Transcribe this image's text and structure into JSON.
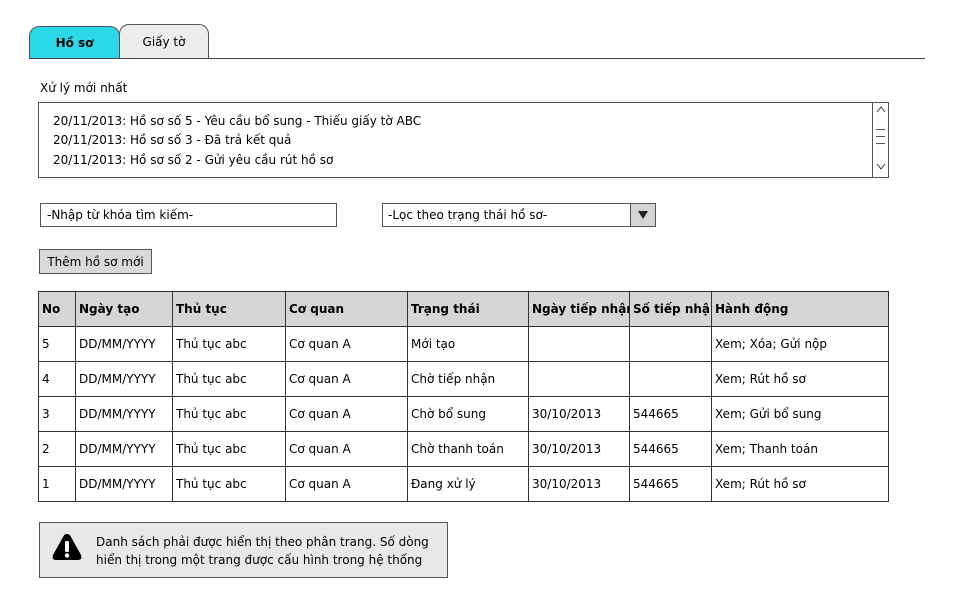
{
  "tabs": [
    {
      "label": "Hồ sơ",
      "active": true
    },
    {
      "label": "Giấy tờ",
      "active": false
    }
  ],
  "recent": {
    "label": "Xử lý mới nhất",
    "lines": [
      "20/11/2013: Hồ sơ số 5 - Yêu cầu bổ sung - Thiếu giấy tờ ABC",
      "20/11/2013: Hồ sơ số 3 - Đã trả kết quả",
      "20/11/2013: Hồ sơ số 2 - Gửi yêu cầu rút hồ sơ"
    ]
  },
  "search": {
    "placeholder": "-Nhập từ khóa tìm kiếm-"
  },
  "filter": {
    "selected": "-Lọc theo trạng thái hồ sơ-"
  },
  "add_button": "Thêm hồ sơ mới",
  "table": {
    "columns": [
      "No",
      "Ngày tạo",
      "Thủ tục",
      "Cơ quan",
      "Trạng thái",
      "Ngày tiếp nhận",
      "Số tiếp nhận",
      "Hành động"
    ],
    "rows": [
      [
        "5",
        "DD/MM/YYYY",
        "Thủ tục abc",
        "Cơ quan A",
        "Mới tạo",
        "",
        "",
        "Xem; Xóa; Gửi nộp"
      ],
      [
        "4",
        "DD/MM/YYYY",
        "Thủ tục abc",
        "Cơ quan A",
        "Chờ tiếp nhận",
        "",
        "",
        "Xem; Rút hồ sơ"
      ],
      [
        "3",
        "DD/MM/YYYY",
        "Thủ tục abc",
        "Cơ quan A",
        "Chờ bổ sung",
        "30/10/2013",
        "544665",
        "Xem; Gửi bổ sung"
      ],
      [
        "2",
        "DD/MM/YYYY",
        "Thủ tục abc",
        "Cơ quan A",
        "Chờ thanh toán",
        "30/10/2013",
        "544665",
        "Xem; Thanh toán"
      ],
      [
        "1",
        "DD/MM/YYYY",
        "Thủ tục abc",
        "Cơ quan A",
        "Đang xử lý",
        "30/10/2013",
        "544665",
        "Xem; Rút hồ sơ"
      ]
    ]
  },
  "note": {
    "icon": "warning-icon",
    "text": "Danh sách phải được hiển thị theo phân trang. Số dòng hiển thị trong một trang được cấu hình trong hệ thống"
  },
  "colors": {
    "active_tab": "#2ad8e8",
    "button": "#d9d9d9",
    "header": "#d6d6d6",
    "note_bg": "#e8e8e8"
  }
}
